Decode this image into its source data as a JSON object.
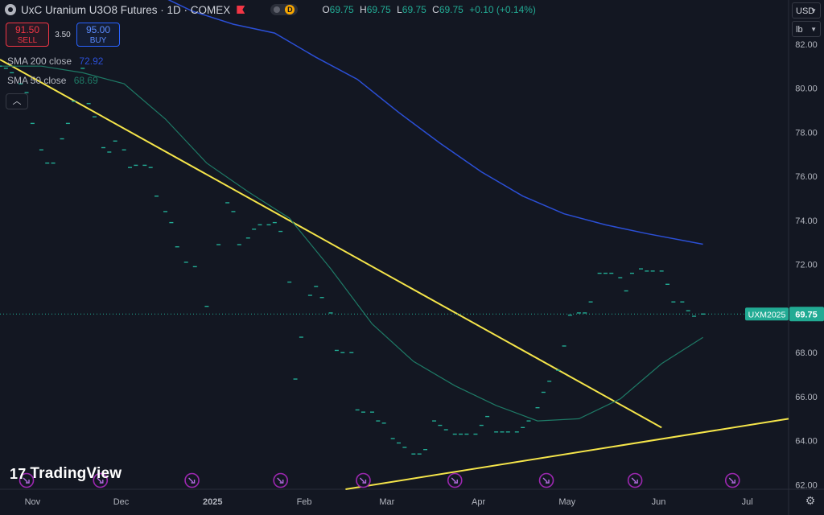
{
  "header": {
    "title": "UxC Uranium U3O8 Futures · 1D · COMEX",
    "d_badge": "D",
    "ohlc": {
      "o_label": "O",
      "o": "69.75",
      "h_label": "H",
      "h": "69.75",
      "l_label": "L",
      "l": "69.75",
      "c_label": "C",
      "c": "69.75",
      "change": "+0.10 (+0.14%)"
    }
  },
  "trade": {
    "sell_price": "91.50",
    "sell_label": "SELL",
    "spread": "3.50",
    "buy_price": "95.00",
    "buy_label": "BUY"
  },
  "indicators": [
    {
      "label": "SMA 200 close",
      "value": "72.92",
      "color": "#2b4fd6"
    },
    {
      "label": "SMA 50 close",
      "value": "68.69",
      "color": "#1e7a66"
    }
  ],
  "axis_controls": {
    "currency": "USD",
    "unit": "lb"
  },
  "watermark": "TradingView",
  "colors": {
    "background": "#131722",
    "up": "#22ab94",
    "sma200": "#2b4fd6",
    "sma50": "#1e7a66",
    "trend": "#f5e54a",
    "grid": "#1e222d"
  },
  "icons": {
    "event": "arrow-event-icon",
    "settings": "gear-icon"
  },
  "chart_data": {
    "type": "line",
    "symbol_tag": "UXM2025",
    "last_price": 69.75,
    "ylim": [
      61.8,
      84
    ],
    "y_ticks": [
      62,
      64,
      66,
      68,
      70,
      72,
      74,
      76,
      78,
      80,
      82
    ],
    "x_start": "2024-10-21",
    "x_end": "2025-07-15",
    "x_ticks": [
      {
        "date": "2024-11-01",
        "label": "Nov"
      },
      {
        "date": "2024-12-01",
        "label": "Dec"
      },
      {
        "date": "2025-01-01",
        "label": "2025"
      },
      {
        "date": "2025-02-01",
        "label": "Feb"
      },
      {
        "date": "2025-03-01",
        "label": "Mar"
      },
      {
        "date": "2025-04-01",
        "label": "Apr"
      },
      {
        "date": "2025-05-01",
        "label": "May"
      },
      {
        "date": "2025-06-01",
        "label": "Jun"
      },
      {
        "date": "2025-07-01",
        "label": "Jul"
      }
    ],
    "price_series": {
      "name": "UXM2025",
      "points": [
        [
          "2024-10-21",
          81.0
        ],
        [
          "2024-10-23",
          80.9
        ],
        [
          "2024-10-25",
          80.7
        ],
        [
          "2024-10-28",
          80.2
        ],
        [
          "2024-10-30",
          79.8
        ],
        [
          "2024-11-01",
          78.4
        ],
        [
          "2024-11-04",
          77.2
        ],
        [
          "2024-11-06",
          76.6
        ],
        [
          "2024-11-08",
          76.6
        ],
        [
          "2024-11-11",
          77.7
        ],
        [
          "2024-11-13",
          78.4
        ],
        [
          "2024-11-15",
          79.4
        ],
        [
          "2024-11-18",
          80.9
        ],
        [
          "2024-11-20",
          79.3
        ],
        [
          "2024-11-22",
          78.7
        ],
        [
          "2024-11-25",
          77.3
        ],
        [
          "2024-11-27",
          77.1
        ],
        [
          "2024-11-29",
          77.6
        ],
        [
          "2024-12-02",
          77.2
        ],
        [
          "2024-12-04",
          76.4
        ],
        [
          "2024-12-06",
          76.5
        ],
        [
          "2024-12-09",
          76.5
        ],
        [
          "2024-12-11",
          76.4
        ],
        [
          "2024-12-13",
          75.1
        ],
        [
          "2024-12-16",
          74.4
        ],
        [
          "2024-12-18",
          73.9
        ],
        [
          "2024-12-20",
          72.8
        ],
        [
          "2024-12-23",
          72.1
        ],
        [
          "2024-12-26",
          71.9
        ],
        [
          "2024-12-30",
          70.1
        ],
        [
          "2025-01-03",
          72.9
        ],
        [
          "2025-01-06",
          74.8
        ],
        [
          "2025-01-08",
          74.4
        ],
        [
          "2025-01-10",
          72.9
        ],
        [
          "2025-01-13",
          73.2
        ],
        [
          "2025-01-15",
          73.6
        ],
        [
          "2025-01-17",
          73.8
        ],
        [
          "2025-01-20",
          73.8
        ],
        [
          "2025-01-22",
          73.9
        ],
        [
          "2025-01-24",
          73.5
        ],
        [
          "2025-01-27",
          71.2
        ],
        [
          "2025-01-29",
          66.8
        ],
        [
          "2025-01-31",
          68.7
        ],
        [
          "2025-02-03",
          70.6
        ],
        [
          "2025-02-05",
          71.0
        ],
        [
          "2025-02-07",
          70.5
        ],
        [
          "2025-02-10",
          69.8
        ],
        [
          "2025-02-12",
          68.1
        ],
        [
          "2025-02-14",
          68.0
        ],
        [
          "2025-02-17",
          68.0
        ],
        [
          "2025-02-19",
          65.4
        ],
        [
          "2025-02-21",
          65.3
        ],
        [
          "2025-02-24",
          65.3
        ],
        [
          "2025-02-26",
          64.9
        ],
        [
          "2025-02-28",
          64.8
        ],
        [
          "2025-03-03",
          64.1
        ],
        [
          "2025-03-05",
          63.9
        ],
        [
          "2025-03-07",
          63.7
        ],
        [
          "2025-03-10",
          63.4
        ],
        [
          "2025-03-12",
          63.4
        ],
        [
          "2025-03-14",
          63.6
        ],
        [
          "2025-03-17",
          64.9
        ],
        [
          "2025-03-19",
          64.7
        ],
        [
          "2025-03-21",
          64.5
        ],
        [
          "2025-03-24",
          64.3
        ],
        [
          "2025-03-26",
          64.3
        ],
        [
          "2025-03-28",
          64.3
        ],
        [
          "2025-03-31",
          64.3
        ],
        [
          "2025-04-02",
          64.7
        ],
        [
          "2025-04-04",
          65.1
        ],
        [
          "2025-04-07",
          64.4
        ],
        [
          "2025-04-09",
          64.4
        ],
        [
          "2025-04-11",
          64.4
        ],
        [
          "2025-04-14",
          64.4
        ],
        [
          "2025-04-16",
          64.6
        ],
        [
          "2025-04-18",
          64.9
        ],
        [
          "2025-04-21",
          65.5
        ],
        [
          "2025-04-23",
          66.2
        ],
        [
          "2025-04-25",
          66.7
        ],
        [
          "2025-04-28",
          67.2
        ],
        [
          "2025-04-30",
          68.3
        ],
        [
          "2025-05-02",
          69.7
        ],
        [
          "2025-05-05",
          69.8
        ],
        [
          "2025-05-07",
          69.8
        ],
        [
          "2025-05-09",
          70.3
        ],
        [
          "2025-05-12",
          71.6
        ],
        [
          "2025-05-14",
          71.6
        ],
        [
          "2025-05-16",
          71.6
        ],
        [
          "2025-05-19",
          71.4
        ],
        [
          "2025-05-21",
          70.8
        ],
        [
          "2025-05-23",
          71.6
        ],
        [
          "2025-05-26",
          71.8
        ],
        [
          "2025-05-28",
          71.7
        ],
        [
          "2025-05-30",
          71.7
        ],
        [
          "2025-06-02",
          71.7
        ],
        [
          "2025-06-04",
          71.1
        ],
        [
          "2025-06-06",
          70.3
        ],
        [
          "2025-06-09",
          70.3
        ],
        [
          "2025-06-11",
          69.9
        ],
        [
          "2025-06-13",
          69.65
        ],
        [
          "2025-06-16",
          69.75
        ]
      ]
    },
    "sma_200": {
      "name": "SMA 200 close",
      "points": [
        [
          "2024-11-27",
          85.6
        ],
        [
          "2024-12-11",
          84.4
        ],
        [
          "2024-12-25",
          83.5
        ],
        [
          "2025-01-08",
          82.9
        ],
        [
          "2025-01-22",
          82.5
        ],
        [
          "2025-02-05",
          81.4
        ],
        [
          "2025-02-19",
          80.4
        ],
        [
          "2025-03-05",
          78.9
        ],
        [
          "2025-03-19",
          77.5
        ],
        [
          "2025-04-02",
          76.2
        ],
        [
          "2025-04-16",
          75.1
        ],
        [
          "2025-04-30",
          74.3
        ],
        [
          "2025-05-14",
          73.8
        ],
        [
          "2025-05-28",
          73.4
        ],
        [
          "2025-06-16",
          72.92
        ]
      ]
    },
    "sma_50": {
      "name": "SMA 50 close",
      "points": [
        [
          "2024-10-21",
          81.0
        ],
        [
          "2024-11-04",
          81.0
        ],
        [
          "2024-11-18",
          80.7
        ],
        [
          "2024-12-02",
          80.2
        ],
        [
          "2024-12-16",
          78.6
        ],
        [
          "2024-12-30",
          76.6
        ],
        [
          "2025-01-13",
          75.3
        ],
        [
          "2025-01-27",
          74.1
        ],
        [
          "2025-02-10",
          71.8
        ],
        [
          "2025-02-24",
          69.3
        ],
        [
          "2025-03-10",
          67.6
        ],
        [
          "2025-03-24",
          66.5
        ],
        [
          "2025-04-07",
          65.6
        ],
        [
          "2025-04-21",
          64.9
        ],
        [
          "2025-05-05",
          65.0
        ],
        [
          "2025-05-19",
          65.9
        ],
        [
          "2025-06-02",
          67.5
        ],
        [
          "2025-06-16",
          68.69
        ]
      ]
    },
    "trendlines": [
      {
        "from": [
          "2024-10-21",
          81.3
        ],
        "to": [
          "2025-06-02",
          64.6
        ]
      },
      {
        "from": [
          "2025-02-15",
          61.8
        ],
        "to": [
          "2025-07-15",
          65.0
        ]
      }
    ],
    "event_markers": [
      "2024-10-30",
      "2024-11-24",
      "2024-12-25",
      "2025-01-24",
      "2025-02-21",
      "2025-03-24",
      "2025-04-24",
      "2025-05-24",
      "2025-06-26"
    ],
    "grid": false,
    "legend": "top-left"
  }
}
